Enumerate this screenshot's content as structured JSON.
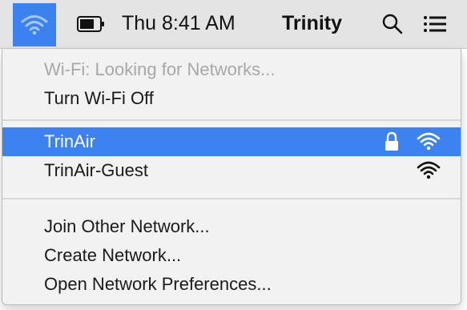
{
  "menubar": {
    "wifi_icon": "wifi-icon",
    "battery_icon": "battery-icon",
    "clock": "Thu 8:41 AM",
    "user": "Trinity",
    "spotlight_icon": "magnifying-glass-icon",
    "notification_icon": "list-icon",
    "accent_color": "#3b82f0"
  },
  "wifi_menu": {
    "status": "Wi-Fi: Looking for Networks...",
    "toggle_label": "Turn Wi-Fi Off",
    "networks": [
      {
        "name": "TrinAir",
        "secured": true,
        "selected": true,
        "signal_icon": "wifi-signal-icon"
      },
      {
        "name": "TrinAir-Guest",
        "secured": false,
        "selected": false,
        "signal_icon": "wifi-signal-icon"
      }
    ],
    "actions": [
      "Join Other Network...",
      "Create Network...",
      "Open Network Preferences..."
    ],
    "highlight_color": "#3c82f0"
  }
}
